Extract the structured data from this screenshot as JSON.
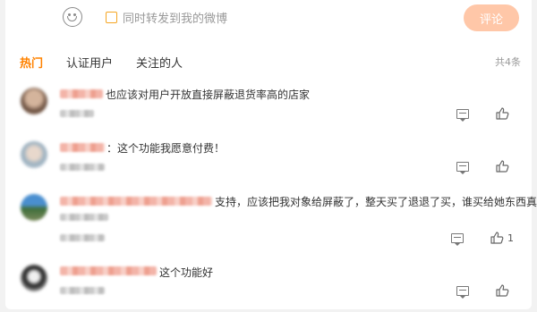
{
  "composer": {
    "emoji_icon": "smiley-face-icon",
    "repost_label": "同时转发到我的微博",
    "submit_label": "评论",
    "submit_color": "#ffc7a8"
  },
  "tabs": [
    {
      "label": "热门",
      "active": true
    },
    {
      "label": "认证用户",
      "active": false
    },
    {
      "label": "关注的人",
      "active": false
    }
  ],
  "total_label": "共4条",
  "accent_color": "#ff8200",
  "comments": [
    {
      "text": "也应该对用户开放直接屏蔽退货率高的店家",
      "likes": ""
    },
    {
      "text": "：这个功能我愿意付费！",
      "likes": ""
    },
    {
      "text": "支持，应该把我对象给屏蔽了，整天买了退退了买，谁买给她东西真",
      "text2": "",
      "likes": "1"
    },
    {
      "text": "这个功能好",
      "likes": ""
    }
  ]
}
